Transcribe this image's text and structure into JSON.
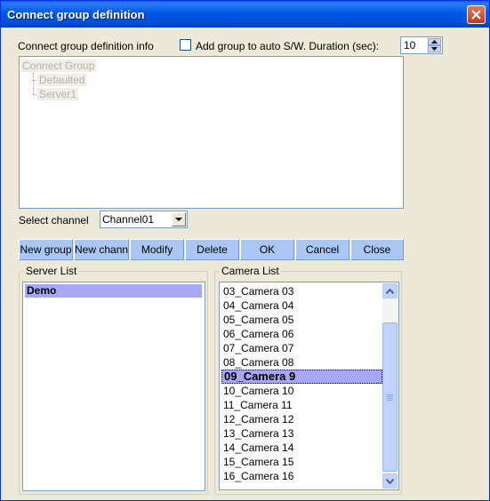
{
  "window": {
    "title": "Connect group definition",
    "close_icon": "close-x-icon"
  },
  "info": {
    "label": "Connect group definition info",
    "auto_sw_label": "Add group to auto S/W. Duration (sec):",
    "auto_sw_checked": false,
    "duration_value": "10"
  },
  "tree": {
    "root": "Connect Group",
    "children": [
      "Defaulted",
      "Server1"
    ]
  },
  "channel": {
    "label": "Select channel",
    "value": "Channel01"
  },
  "buttons": {
    "new_group": "New group",
    "new_channel": "New channel",
    "modify": "Modify",
    "delete": "Delete",
    "ok": "OK",
    "cancel": "Cancel",
    "close": "Close"
  },
  "server_list": {
    "title": "Server List",
    "items": [
      "Demo"
    ],
    "selected": "Demo"
  },
  "camera_list": {
    "title": "Camera List",
    "items": [
      "03_Camera 03",
      "04_Camera 04",
      "05_Camera 05",
      "06_Camera 06",
      "07_Camera 07",
      "08_Camera 08",
      "09_Camera 9",
      "10_Camera 10",
      "11_Camera 11",
      "12_Camera 12",
      "13_Camera 13",
      "14_Camera 14",
      "15_Camera 15",
      "16_Camera 16"
    ],
    "selected": "09_Camera 9"
  },
  "colors": {
    "selection": "#A7A7F5",
    "button_face": "#A9C7F2",
    "dialog_bg": "#ECE9D8"
  }
}
